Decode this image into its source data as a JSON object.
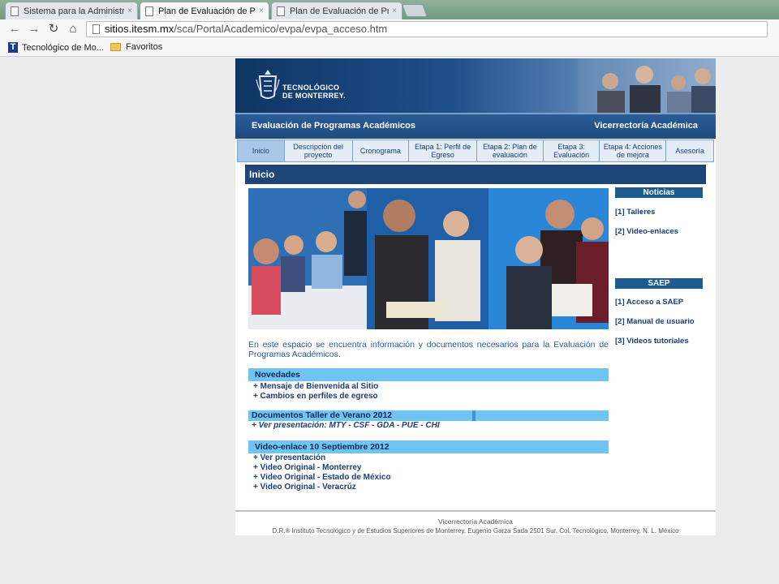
{
  "browser": {
    "tabs": [
      {
        "label": "Sistema para la Administra",
        "active": false
      },
      {
        "label": "Plan de Evaluación de Prog",
        "active": true
      },
      {
        "label": "Plan de Evaluación de Prog",
        "active": false
      }
    ],
    "close_glyph": "×",
    "url_host": "sitios.itesm.mx",
    "url_path": "/sca/PortalAcademico/evpa/evpa_acceso.htm",
    "bookmarks": [
      {
        "label": "Tecnológico de Mo...",
        "icon": "t-icon"
      },
      {
        "label": "Favoritos",
        "icon": "folder-icon"
      }
    ],
    "bookmark_icon_letter": "T"
  },
  "site": {
    "logo_line1": "TECNOLÓGICO",
    "logo_line2": "DE MONTERREY.",
    "title": "Evaluación de Programas Académicos",
    "subtitle": "Vicerrectoría Académica"
  },
  "nav": [
    {
      "label": "Inicio",
      "active": true
    },
    {
      "label": "Descripción del proyecto",
      "active": false
    },
    {
      "label": "Cronograma",
      "active": false
    },
    {
      "label": "Etapa 1: Perfil de Egreso",
      "active": false
    },
    {
      "label": "Etapa 2: Plan de evaluación",
      "active": false
    },
    {
      "label": "Etapa 3: Evaluación",
      "active": false
    },
    {
      "label": "Etapa 4: Acciones de mejora",
      "active": false
    },
    {
      "label": "Asesoría",
      "active": false
    }
  ],
  "main": {
    "heading": "Inicio",
    "intro": "En este espacio se encuentra información y documentos necesarios para la Evaluación de Programas Académicos.",
    "novedades": {
      "title": "Novedades",
      "items": [
        "+ Mensaje de Bienvenida al Sitio",
        "+ Cambios en perfiles de egreso"
      ]
    },
    "taller": {
      "title": "Documentos Taller de Verano 2012",
      "line": "+ Ver presentación: MTY - CSF - GDA - PUE - CHI"
    },
    "videoenlace": {
      "title": "Video-enlace 10 Septiembre 2012",
      "items": [
        "+ Ver presentación",
        "+ Video Original - Monterrey",
        "+ Video Original - Estado de México",
        "+ Video Original - Veracrúz"
      ]
    }
  },
  "sidebar": {
    "noticias_title": "Noticias",
    "noticias": [
      "[1] Talleres",
      "[2] Video-enlaces"
    ],
    "saep_title": "SAEP",
    "saep": [
      "[1] Acceso a SAEP",
      "[2] Manual de usuario",
      "[3] Videos tutoriales"
    ]
  },
  "footer": {
    "line1": "Vicerrectoría Académica",
    "line2": "D.R.® Instituto Tecnológico y de Estudios Superiores de Monterrey, Eugenio Garza Sada 2501 Sur, Col. Tecnológico, Monterrey, N. L. México"
  },
  "colors": {
    "header_navy": "#1e4577",
    "accent_bar": "#70c4f2",
    "link_blue": "#173f78"
  }
}
